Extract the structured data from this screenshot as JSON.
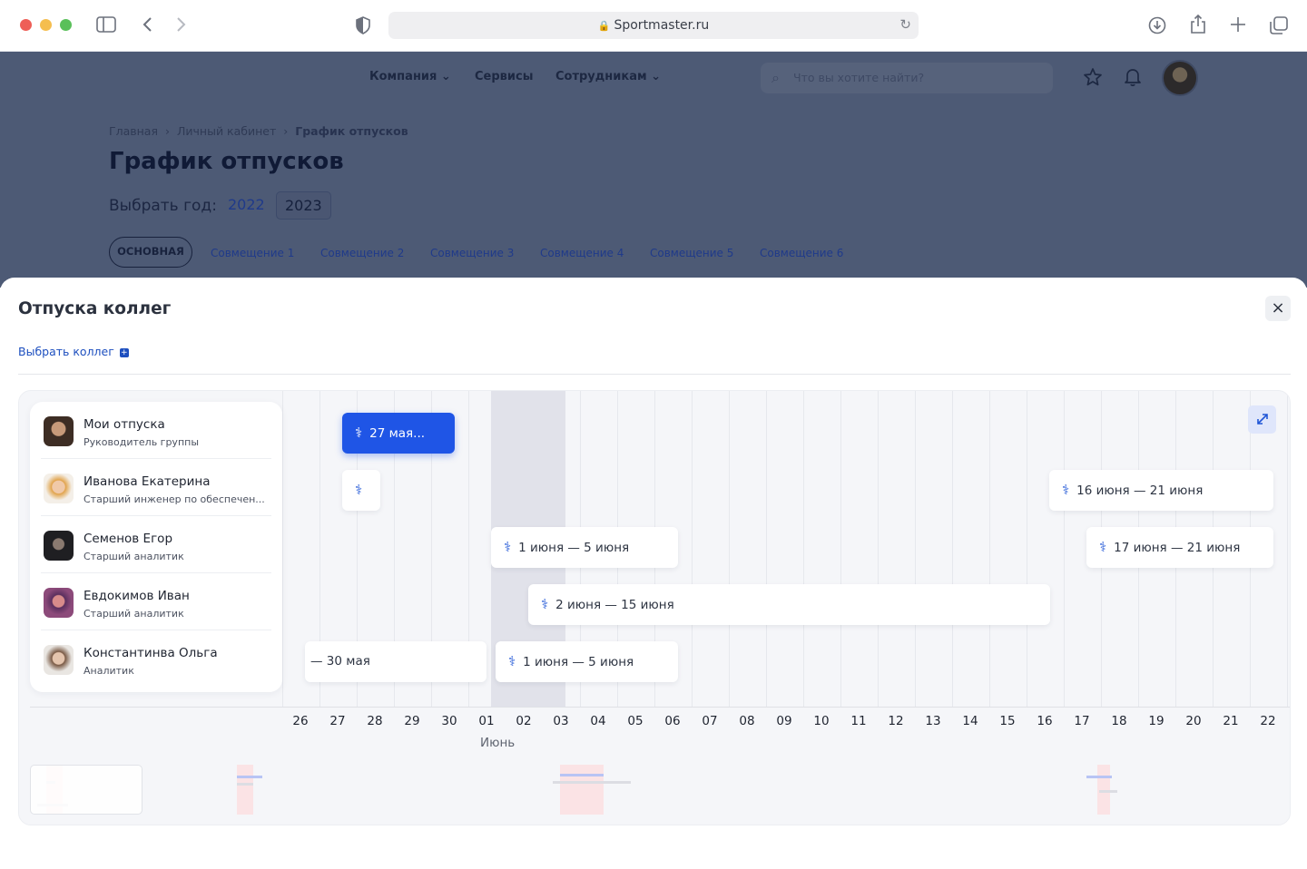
{
  "browser": {
    "url": "Sportmaster.ru",
    "colors": {
      "close": "#ee5f57",
      "minimize": "#f5be4f",
      "maximize": "#5ac05a"
    }
  },
  "page": {
    "nav": [
      "Компания",
      "Сервисы",
      "Сотрудникам"
    ],
    "search_placeholder": "Что вы хотите найти?",
    "breadcrumbs": [
      "Главная",
      "Личный кабинет",
      "График отпусков"
    ],
    "title": "График отпусков",
    "year_label": "Выбрать год:",
    "years": [
      "2022",
      "2023"
    ],
    "tabs": [
      "ОСНОВНАЯ",
      "Совмещение 1",
      "Совмещение 2",
      "Совмещение 3",
      "Совмещение 4",
      "Совмещение 5",
      "Совмещение 6"
    ]
  },
  "modal": {
    "title": "Отпуска коллег",
    "close_icon": "×",
    "pick_colleagues": "Выбрать коллег",
    "people": [
      {
        "name": "Мои отпуска",
        "role": "Руководитель группы"
      },
      {
        "name": "Иванова Екатерина",
        "role": "Старший инженер по обеспечен..."
      },
      {
        "name": "Семенов Егор",
        "role": "Старший аналитик"
      },
      {
        "name": "Евдокимов Иван",
        "role": "Старший аналитик"
      },
      {
        "name": "Константинва Ольга",
        "role": "Аналитик"
      }
    ],
    "bars": [
      "27 мая...",
      "16 июня — 21 июня",
      "1 июня — 5 июня",
      "17 июня — 21 июня",
      "2 июня — 15 июня",
      "— 30 мая",
      "1 июня — 5 июня"
    ],
    "days": [
      "26",
      "27",
      "28",
      "29",
      "30",
      "01",
      "02",
      "03",
      "04",
      "05",
      "06",
      "07",
      "08",
      "09",
      "10",
      "11",
      "12",
      "13",
      "14",
      "15",
      "16",
      "17",
      "18",
      "19",
      "20",
      "21",
      "22"
    ],
    "month": "Июнь",
    "accent": "#1f55e6"
  }
}
